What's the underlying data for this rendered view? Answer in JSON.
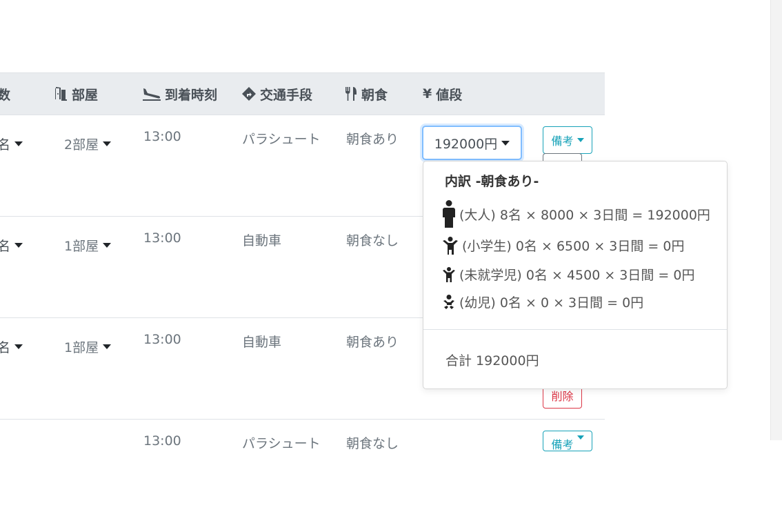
{
  "header": {
    "col_guests_partial": "数",
    "col_rooms": "部屋",
    "col_arrival": "到着時刻",
    "col_transport": "交通手段",
    "col_breakfast": "朝食",
    "col_price": "値段",
    "price_symbol": "¥"
  },
  "icons": {
    "rooms": "door-open-icon",
    "arrival": "plane-landing-icon",
    "transport": "directions-icon",
    "breakfast": "utensils-icon",
    "adult": "adult-person-icon",
    "child": "child-icon",
    "preschool": "small-child-icon",
    "infant": "baby-icon"
  },
  "rows": [
    {
      "guests": "名",
      "rooms": "2部屋",
      "arrival": "13:00",
      "transport": "パラシュート",
      "breakfast": "朝食あり",
      "price": "192000円",
      "note": "備考"
    },
    {
      "guests": "名",
      "rooms": "1部屋",
      "arrival": "13:00",
      "transport": "自動車",
      "breakfast": "朝食なし"
    },
    {
      "guests": "名",
      "rooms": "1部屋",
      "arrival": "13:00",
      "transport": "自動車",
      "breakfast": "朝食あり",
      "delete": "削除"
    },
    {
      "arrival": "13:00",
      "transport": "パラシュート",
      "breakfast": "朝食なし",
      "note": "備考"
    }
  ],
  "popover": {
    "title": "内訳 -朝食あり-",
    "lines": [
      "(大人) 8名 × 8000 × 3日間 = 192000円",
      "(小学生) 0名 × 6500 × 3日間 = 0円",
      "(未就学児) 0名 × 4500 × 3日間 = 0円",
      "(幼児) 0名 × 0 × 3日間 = 0円"
    ],
    "total": "合計 192000円"
  },
  "colors": {
    "header_bg": "#e9ecef",
    "focus_border": "#80bdff",
    "info": "#17a2b8",
    "danger": "#dc3545",
    "muted_text": "#6c757d"
  }
}
